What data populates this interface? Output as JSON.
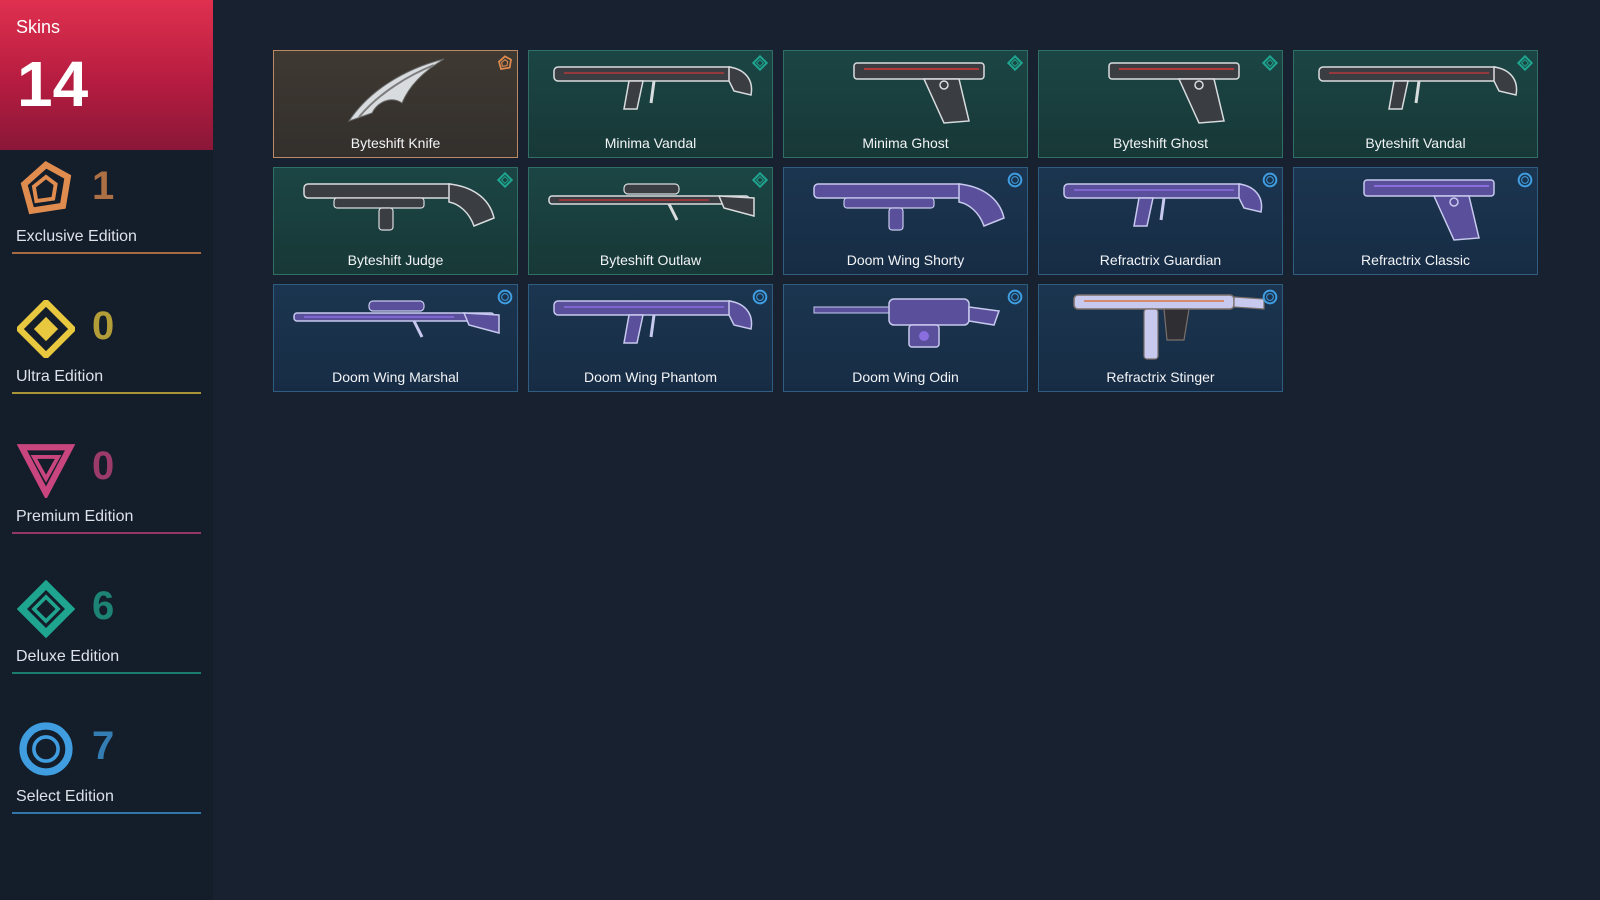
{
  "summary": {
    "label": "Skins",
    "total": "14"
  },
  "colors": {
    "exclusive": "#e08c4f",
    "ultra": "#e8c83f",
    "premium": "#c9457e",
    "deluxe": "#1fa58f",
    "select": "#3f9de0"
  },
  "tiers": [
    {
      "key": "exclusive",
      "icon": "exclusive-tier-icon",
      "count": "1",
      "label": "Exclusive Edition"
    },
    {
      "key": "ultra",
      "icon": "ultra-tier-icon",
      "count": "0",
      "label": "Ultra Edition"
    },
    {
      "key": "premium",
      "icon": "premium-tier-icon",
      "count": "0",
      "label": "Premium Edition"
    },
    {
      "key": "deluxe",
      "icon": "deluxe-tier-icon",
      "count": "6",
      "label": "Deluxe Edition"
    },
    {
      "key": "select",
      "icon": "select-tier-icon",
      "count": "7",
      "label": "Select Edition"
    }
  ],
  "skins": [
    {
      "name": "Byteshift Knife",
      "tier": "exclusive",
      "weapon": "knife"
    },
    {
      "name": "Minima Vandal",
      "tier": "deluxe",
      "weapon": "rifle"
    },
    {
      "name": "Minima Ghost",
      "tier": "deluxe",
      "weapon": "pistol"
    },
    {
      "name": "Byteshift Ghost",
      "tier": "deluxe",
      "weapon": "pistol"
    },
    {
      "name": "Byteshift Vandal",
      "tier": "deluxe",
      "weapon": "rifle"
    },
    {
      "name": "Byteshift Judge",
      "tier": "deluxe",
      "weapon": "shotgun"
    },
    {
      "name": "Byteshift Outlaw",
      "tier": "deluxe",
      "weapon": "sniper"
    },
    {
      "name": "Doom Wing Shorty",
      "tier": "select",
      "weapon": "shotgun"
    },
    {
      "name": "Refractrix Guardian",
      "tier": "select",
      "weapon": "rifle"
    },
    {
      "name": "Refractrix Classic",
      "tier": "select",
      "weapon": "pistol"
    },
    {
      "name": "Doom Wing Marshal",
      "tier": "select",
      "weapon": "sniper"
    },
    {
      "name": "Doom Wing Phantom",
      "tier": "select",
      "weapon": "rifle"
    },
    {
      "name": "Doom Wing Odin",
      "tier": "select",
      "weapon": "heavy"
    },
    {
      "name": "Refractrix Stinger",
      "tier": "select",
      "weapon": "smg"
    }
  ]
}
